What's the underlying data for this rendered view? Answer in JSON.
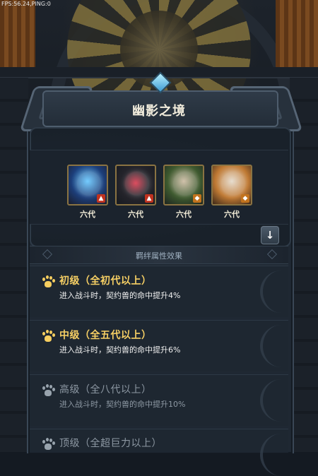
{
  "fps_text": "FPS:56.24,PING:0",
  "title": "幽影之境",
  "pets": [
    {
      "gen_label": "六代",
      "element_icon": "fire-element-icon",
      "element_glyph": "🔥"
    },
    {
      "gen_label": "六代",
      "element_icon": "fire-element-icon",
      "element_glyph": "🔥"
    },
    {
      "gen_label": "六代",
      "element_icon": "earth-element-icon",
      "element_glyph": "◆"
    },
    {
      "gen_label": "六代",
      "element_icon": "earth-element-icon",
      "element_glyph": "◆"
    }
  ],
  "expand_button_glyph": "↓",
  "bond_header": "羁绊属性效果",
  "tiers": [
    {
      "title": "初级（全初代以上）",
      "desc": "进入战斗时，契约兽的命中提升4%",
      "active": true
    },
    {
      "title": "中级（全五代以上）",
      "desc": "进入战斗时，契约兽的命中提升6%",
      "active": true
    },
    {
      "title": "高级（全八代以上）",
      "desc": "进入战斗时，契约兽的命中提升10%",
      "active": false
    },
    {
      "title": "顶级（全超巨力以上）",
      "desc": "",
      "active": false
    }
  ],
  "colors": {
    "active_title": "#f6cf64",
    "inactive_text": "#8d98a3",
    "panel_bg": "#1f2833"
  }
}
